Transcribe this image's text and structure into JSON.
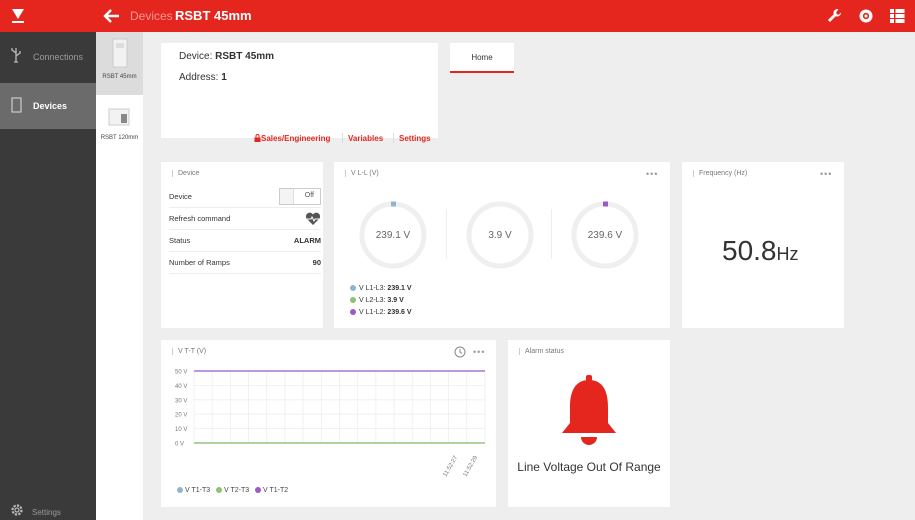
{
  "topbar": {
    "breadcrumb": "Devices",
    "title": "RSBT 45mm",
    "icons": [
      "wrench-icon",
      "eye-icon",
      "grid-list-icon"
    ],
    "accent": "#e5261f"
  },
  "sidenav": {
    "items": [
      {
        "label": "Connections",
        "icon": "usb-icon"
      },
      {
        "label": "Devices",
        "icon": "device-icon"
      }
    ],
    "settings_label": "Settings"
  },
  "devices": [
    {
      "label": "RSBT 45mm"
    },
    {
      "label": "RSBT 120mm"
    }
  ],
  "device_info": {
    "device_label": "Device:",
    "device_name": "RSBT 45mm",
    "address_label": "Address:",
    "address_value": "1",
    "links": [
      "Sales/Engineering",
      "Variables",
      "Settings"
    ]
  },
  "tabs": [
    {
      "label": "Home"
    }
  ],
  "device_card": {
    "title": "Device",
    "rows": [
      {
        "key": "Device",
        "value": "Off"
      },
      {
        "key": "Refresh command",
        "value": ""
      },
      {
        "key": "Status",
        "value": "ALARM"
      },
      {
        "key": "Number of Ramps",
        "value": "90"
      }
    ]
  },
  "vll_card": {
    "title": "V L-L (V)",
    "more": "•••",
    "gauges": [
      {
        "value": "239.1 V",
        "color": "#8fb4cf"
      },
      {
        "value": "3.9 V",
        "color": "#8fc36e"
      },
      {
        "value": "239.6 V",
        "color": "#9b59c9"
      }
    ],
    "legend": [
      {
        "label": "V L1-L3:",
        "value": "239.1 V",
        "color": "#8fb4cf"
      },
      {
        "label": "V L2-L3:",
        "value": "3.9 V",
        "color": "#8fc36e"
      },
      {
        "label": "V L1-L2:",
        "value": "239.6 V",
        "color": "#9b59c9"
      }
    ]
  },
  "freq_card": {
    "title": "Frequency (Hz)",
    "more": "•••",
    "value": "50.8",
    "unit": "Hz"
  },
  "vtt_card": {
    "title": "V T-T (V)",
    "more": "•••",
    "chart_data": {
      "type": "line",
      "y_ticks": [
        "50 V",
        "40 V",
        "30 V",
        "20 V",
        "10 V",
        "0 V"
      ],
      "ylim": [
        0,
        50
      ],
      "x_ticks": [
        "11:52:27",
        "11:52:29"
      ],
      "grid": true,
      "series": [
        {
          "name": "V T1-T3",
          "color": "#8fb4cf",
          "values": [
            0,
            0
          ]
        },
        {
          "name": "V T2-T3",
          "color": "#8fc36e",
          "values": [
            0,
            0
          ]
        },
        {
          "name": "V T1-T2",
          "color": "#9b59c9",
          "values": [
            50,
            50
          ]
        }
      ],
      "legend_position": "bottom"
    }
  },
  "alarm_card": {
    "title": "Alarm status",
    "text": "Line Voltage Out Of Range",
    "icon": "bell-icon",
    "color": "#e5261f"
  }
}
